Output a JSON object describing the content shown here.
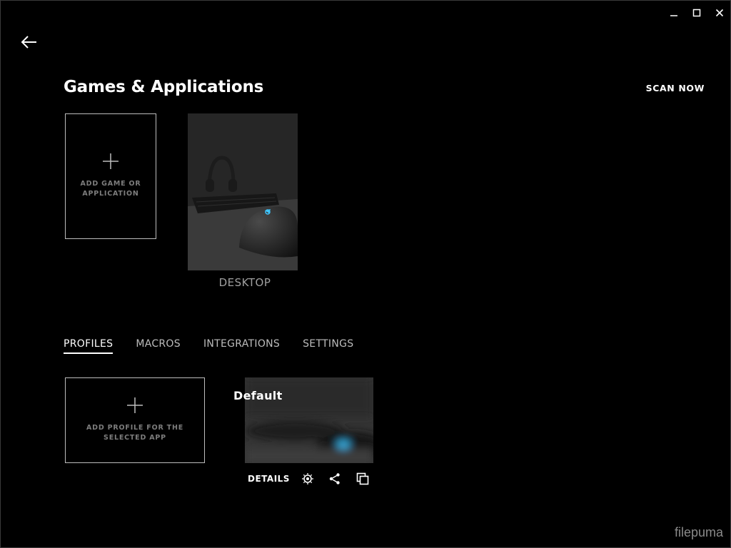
{
  "window": {
    "minimize_icon": "minimize-icon",
    "maximize_icon": "maximize-icon",
    "close_icon": "close-icon"
  },
  "nav": {
    "back_icon": "back-arrow-icon"
  },
  "header": {
    "title": "Games & Applications",
    "scan_now": "SCAN NOW"
  },
  "games": {
    "add_label_line1": "ADD GAME OR",
    "add_label_line2": "APPLICATION",
    "items": [
      {
        "name": "DESKTOP"
      }
    ]
  },
  "tabs": [
    {
      "label": "PROFILES",
      "active": true
    },
    {
      "label": "MACROS",
      "active": false
    },
    {
      "label": "INTEGRATIONS",
      "active": false
    },
    {
      "label": "SETTINGS",
      "active": false
    }
  ],
  "profiles": {
    "add_label_line1": "ADD PROFILE FOR THE",
    "add_label_line2": "SELECTED APP",
    "items": [
      {
        "name": "Default"
      }
    ],
    "details_label": "DETAILS",
    "actions": [
      "persistent-profile-icon",
      "share-icon",
      "duplicate-icon"
    ]
  },
  "watermark": "filepuma",
  "colors": {
    "background": "#000000",
    "accent_blue": "#3ec6ff",
    "muted_text": "#7d7d7d"
  }
}
